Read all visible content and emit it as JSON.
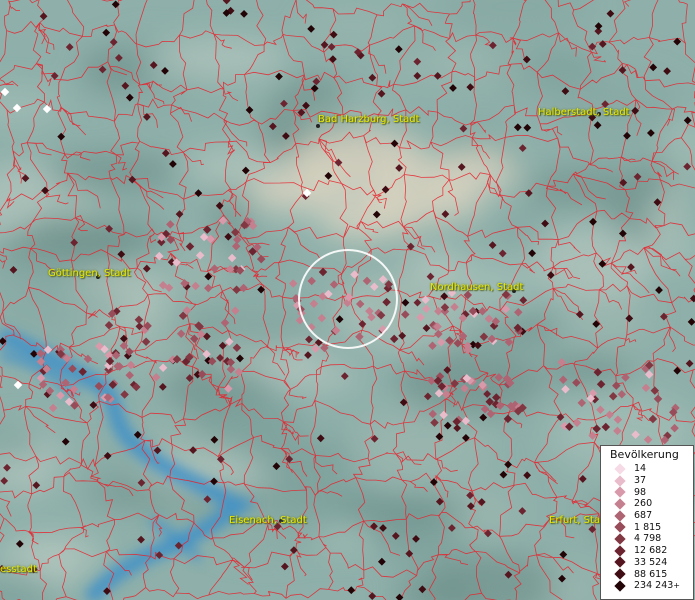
{
  "map": {
    "colors": {
      "boundary": "#e8202a",
      "water": "#3d8fc9",
      "label": "#e8e800",
      "terrain_base": "#8fb0aa",
      "highland": "#d9d2bf"
    },
    "cities": [
      {
        "name": "Bad Harzburg, Stadt",
        "id": "city-bad-harzburg"
      },
      {
        "name": "Halberstadt, Stadt",
        "id": "city-halberstadt"
      },
      {
        "name": "Göttingen, Stadt",
        "id": "city-goettingen"
      },
      {
        "name": "Nordhausen, Stadt",
        "id": "city-nordhausen"
      },
      {
        "name": "Eisenach, Stadt",
        "id": "city-eisenach"
      },
      {
        "name": "Erfurt, Stadt",
        "id": "city-erfurt"
      },
      {
        "name": "esstadt",
        "id": "city-edge-left"
      }
    ],
    "legend": {
      "title": "Bevölkerung",
      "items": [
        {
          "label": "14",
          "color": "#f6dbe6"
        },
        {
          "label": "37",
          "color": "#e9bccb"
        },
        {
          "label": "98",
          "color": "#d89aab"
        },
        {
          "label": "260",
          "color": "#c4808e"
        },
        {
          "label": "687",
          "color": "#ae6472"
        },
        {
          "label": "1 815",
          "color": "#984b59"
        },
        {
          "label": "4 798",
          "color": "#823843"
        },
        {
          "label": "12 682",
          "color": "#6c2530"
        },
        {
          "label": "33 524",
          "color": "#55161f"
        },
        {
          "label": "88 615",
          "color": "#3e0c12"
        },
        {
          "label": "234 243",
          "color": "#220407"
        }
      ],
      "overflow_mark": "+"
    }
  }
}
